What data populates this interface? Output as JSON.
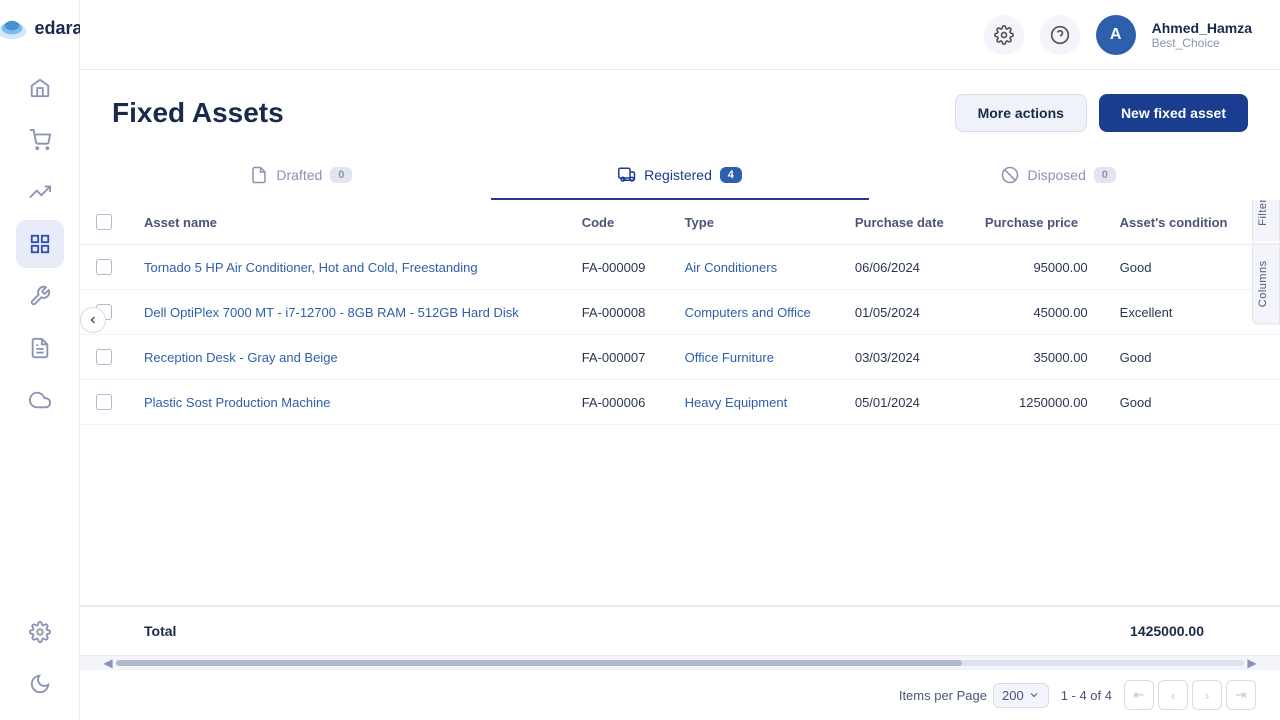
{
  "app": {
    "name": "edara"
  },
  "topbar": {
    "username": "Ahmed_Hamza",
    "company": "Best_Choice",
    "avatar_letter": "A"
  },
  "sidebar": {
    "items": [
      {
        "name": "home",
        "label": "Home",
        "icon": "home"
      },
      {
        "name": "shopping",
        "label": "Shopping",
        "icon": "cart"
      },
      {
        "name": "analytics",
        "label": "Analytics",
        "icon": "chart-up"
      },
      {
        "name": "reports",
        "label": "Reports",
        "icon": "grid",
        "active": true
      },
      {
        "name": "tools",
        "label": "Tools",
        "icon": "wrench"
      },
      {
        "name": "documents",
        "label": "Documents",
        "icon": "doc"
      },
      {
        "name": "cloud",
        "label": "Cloud",
        "icon": "cloud"
      },
      {
        "name": "settings",
        "label": "Settings",
        "icon": "gear"
      },
      {
        "name": "dark-mode",
        "label": "Dark Mode",
        "icon": "moon"
      }
    ]
  },
  "page": {
    "title": "Fixed Assets",
    "buttons": {
      "more_actions": "More actions",
      "new_fixed_asset": "New fixed asset"
    }
  },
  "tabs": [
    {
      "id": "drafted",
      "label": "Drafted",
      "count": 0,
      "active": false
    },
    {
      "id": "registered",
      "label": "Registered",
      "count": 4,
      "active": true
    },
    {
      "id": "disposed",
      "label": "Disposed",
      "count": 0,
      "active": false
    }
  ],
  "table": {
    "columns": [
      "Asset name",
      "Code",
      "Type",
      "Purchase date",
      "Purchase price",
      "Asset's condition"
    ],
    "rows": [
      {
        "asset_name": "Tornado 5 HP Air Conditioner, Hot and Cold, Freestanding",
        "code": "FA-000009",
        "type": "Air Conditioners",
        "purchase_date": "06/06/2024",
        "purchase_price": "95000.00",
        "condition": "Good"
      },
      {
        "asset_name": "Dell OptiPlex 7000 MT - i7-12700 - 8GB RAM - 512GB Hard Disk",
        "code": "FA-000008",
        "type": "Computers and Office",
        "purchase_date": "01/05/2024",
        "purchase_price": "45000.00",
        "condition": "Excellent"
      },
      {
        "asset_name": "Reception Desk - Gray and Beige",
        "code": "FA-000007",
        "type": "Office Furniture",
        "purchase_date": "03/03/2024",
        "purchase_price": "35000.00",
        "condition": "Good"
      },
      {
        "asset_name": "Plastic Sost Production Machine",
        "code": "FA-000006",
        "type": "Heavy Equipment",
        "purchase_date": "05/01/2024",
        "purchase_price": "1250000.00",
        "condition": "Good"
      }
    ],
    "total_label": "Total",
    "total_value": "1425000.00"
  },
  "side_buttons": {
    "filters": "Filters",
    "columns": "Columns"
  },
  "pagination": {
    "items_per_page_label": "Items per Page",
    "per_page_value": "200",
    "page_info": "1 - 4 of 4"
  }
}
